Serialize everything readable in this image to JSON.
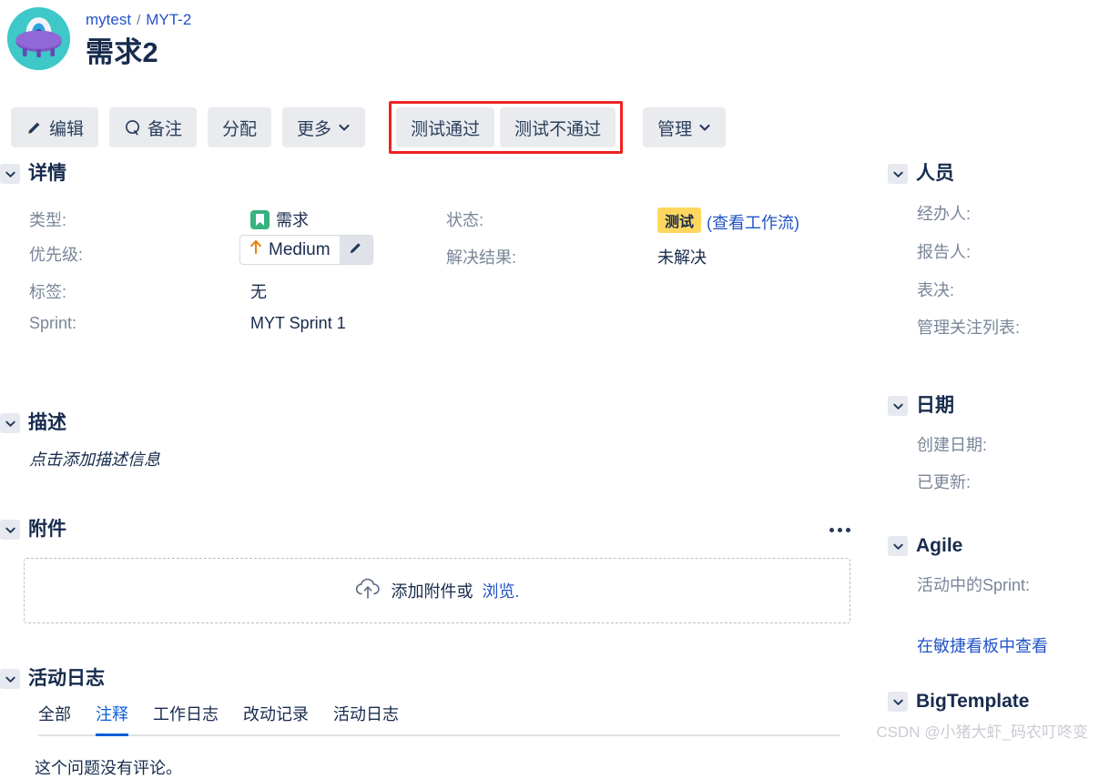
{
  "header": {
    "avatar_icon": "ufo-avatar-icon",
    "breadcrumb_project": "mytest",
    "breadcrumb_sep": "/",
    "breadcrumb_issue": "MYT-2",
    "title": "需求2"
  },
  "toolbar": {
    "edit_label": "编辑",
    "edit_icon": "pencil-icon",
    "comment_label": "备注",
    "comment_icon": "comment-bubble-icon",
    "assign_label": "分配",
    "more_label": "更多",
    "more_icon": "chevron-down-icon",
    "test_pass_label": "测试通过",
    "test_fail_label": "测试不通过",
    "manage_label": "管理",
    "manage_icon": "chevron-down-icon",
    "highlight_color": "#ee2222"
  },
  "details": {
    "section_title": "详情",
    "type_label": "类型:",
    "type_value": "需求",
    "type_icon": "story-bookmark-icon",
    "priority_label": "优先级:",
    "priority_value": "Medium",
    "priority_icon": "arrow-up-icon",
    "priority_edit_icon": "pencil-icon",
    "labels_label": "标签:",
    "labels_value": "无",
    "sprint_label": "Sprint:",
    "sprint_value": "MYT Sprint 1",
    "status_label": "状态:",
    "status_value": "测试",
    "status_color": "#ffd75e",
    "workflow_link": "(查看工作流)",
    "resolution_label": "解决结果:",
    "resolution_value": "未解决"
  },
  "description": {
    "section_title": "描述",
    "placeholder": "点击添加描述信息"
  },
  "attachments": {
    "section_title": "附件",
    "menu_icon": "ellipsis-icon",
    "dropzone_icon": "cloud-upload-icon",
    "dropzone_text": "添加附件或",
    "dropzone_link": "浏览."
  },
  "activity": {
    "section_title": "活动日志",
    "tabs": [
      {
        "label": "全部",
        "active": false
      },
      {
        "label": "注释",
        "active": true
      },
      {
        "label": "工作日志",
        "active": false
      },
      {
        "label": "改动记录",
        "active": false
      },
      {
        "label": "活动日志",
        "active": false
      }
    ],
    "empty_text": "这个问题没有评论。"
  },
  "sidebar": {
    "people": {
      "title": "人员",
      "rows": [
        "经办人:",
        "报告人:",
        "表决:",
        "管理关注列表:"
      ]
    },
    "dates": {
      "title": "日期",
      "rows": [
        "创建日期:",
        "已更新:"
      ]
    },
    "agile": {
      "title": "Agile",
      "rows": [
        "活动中的Sprint:"
      ],
      "board_link": "在敏捷看板中查看"
    },
    "bigtemplate": {
      "title": "BigTemplate"
    }
  },
  "watermark": "CSDN @小猪大虾_码农叮咚变"
}
